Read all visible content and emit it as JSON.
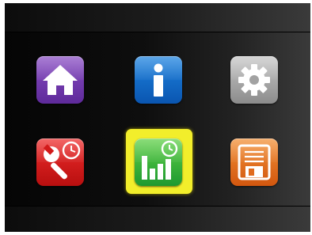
{
  "menu": {
    "items": [
      {
        "icon": "home-icon",
        "color": "#7c42b8"
      },
      {
        "icon": "info-icon",
        "color": "#1565c8"
      },
      {
        "icon": "gear-icon",
        "color": "#a9a9a9"
      },
      {
        "icon": "wrench-clock-icon",
        "color": "#d61d1d"
      },
      {
        "icon": "bar-chart-clock-icon",
        "color": "#3bb53f",
        "selected": true
      },
      {
        "icon": "save-icon",
        "color": "#e6731f"
      }
    ],
    "selection_color": "#f2ee2b"
  }
}
